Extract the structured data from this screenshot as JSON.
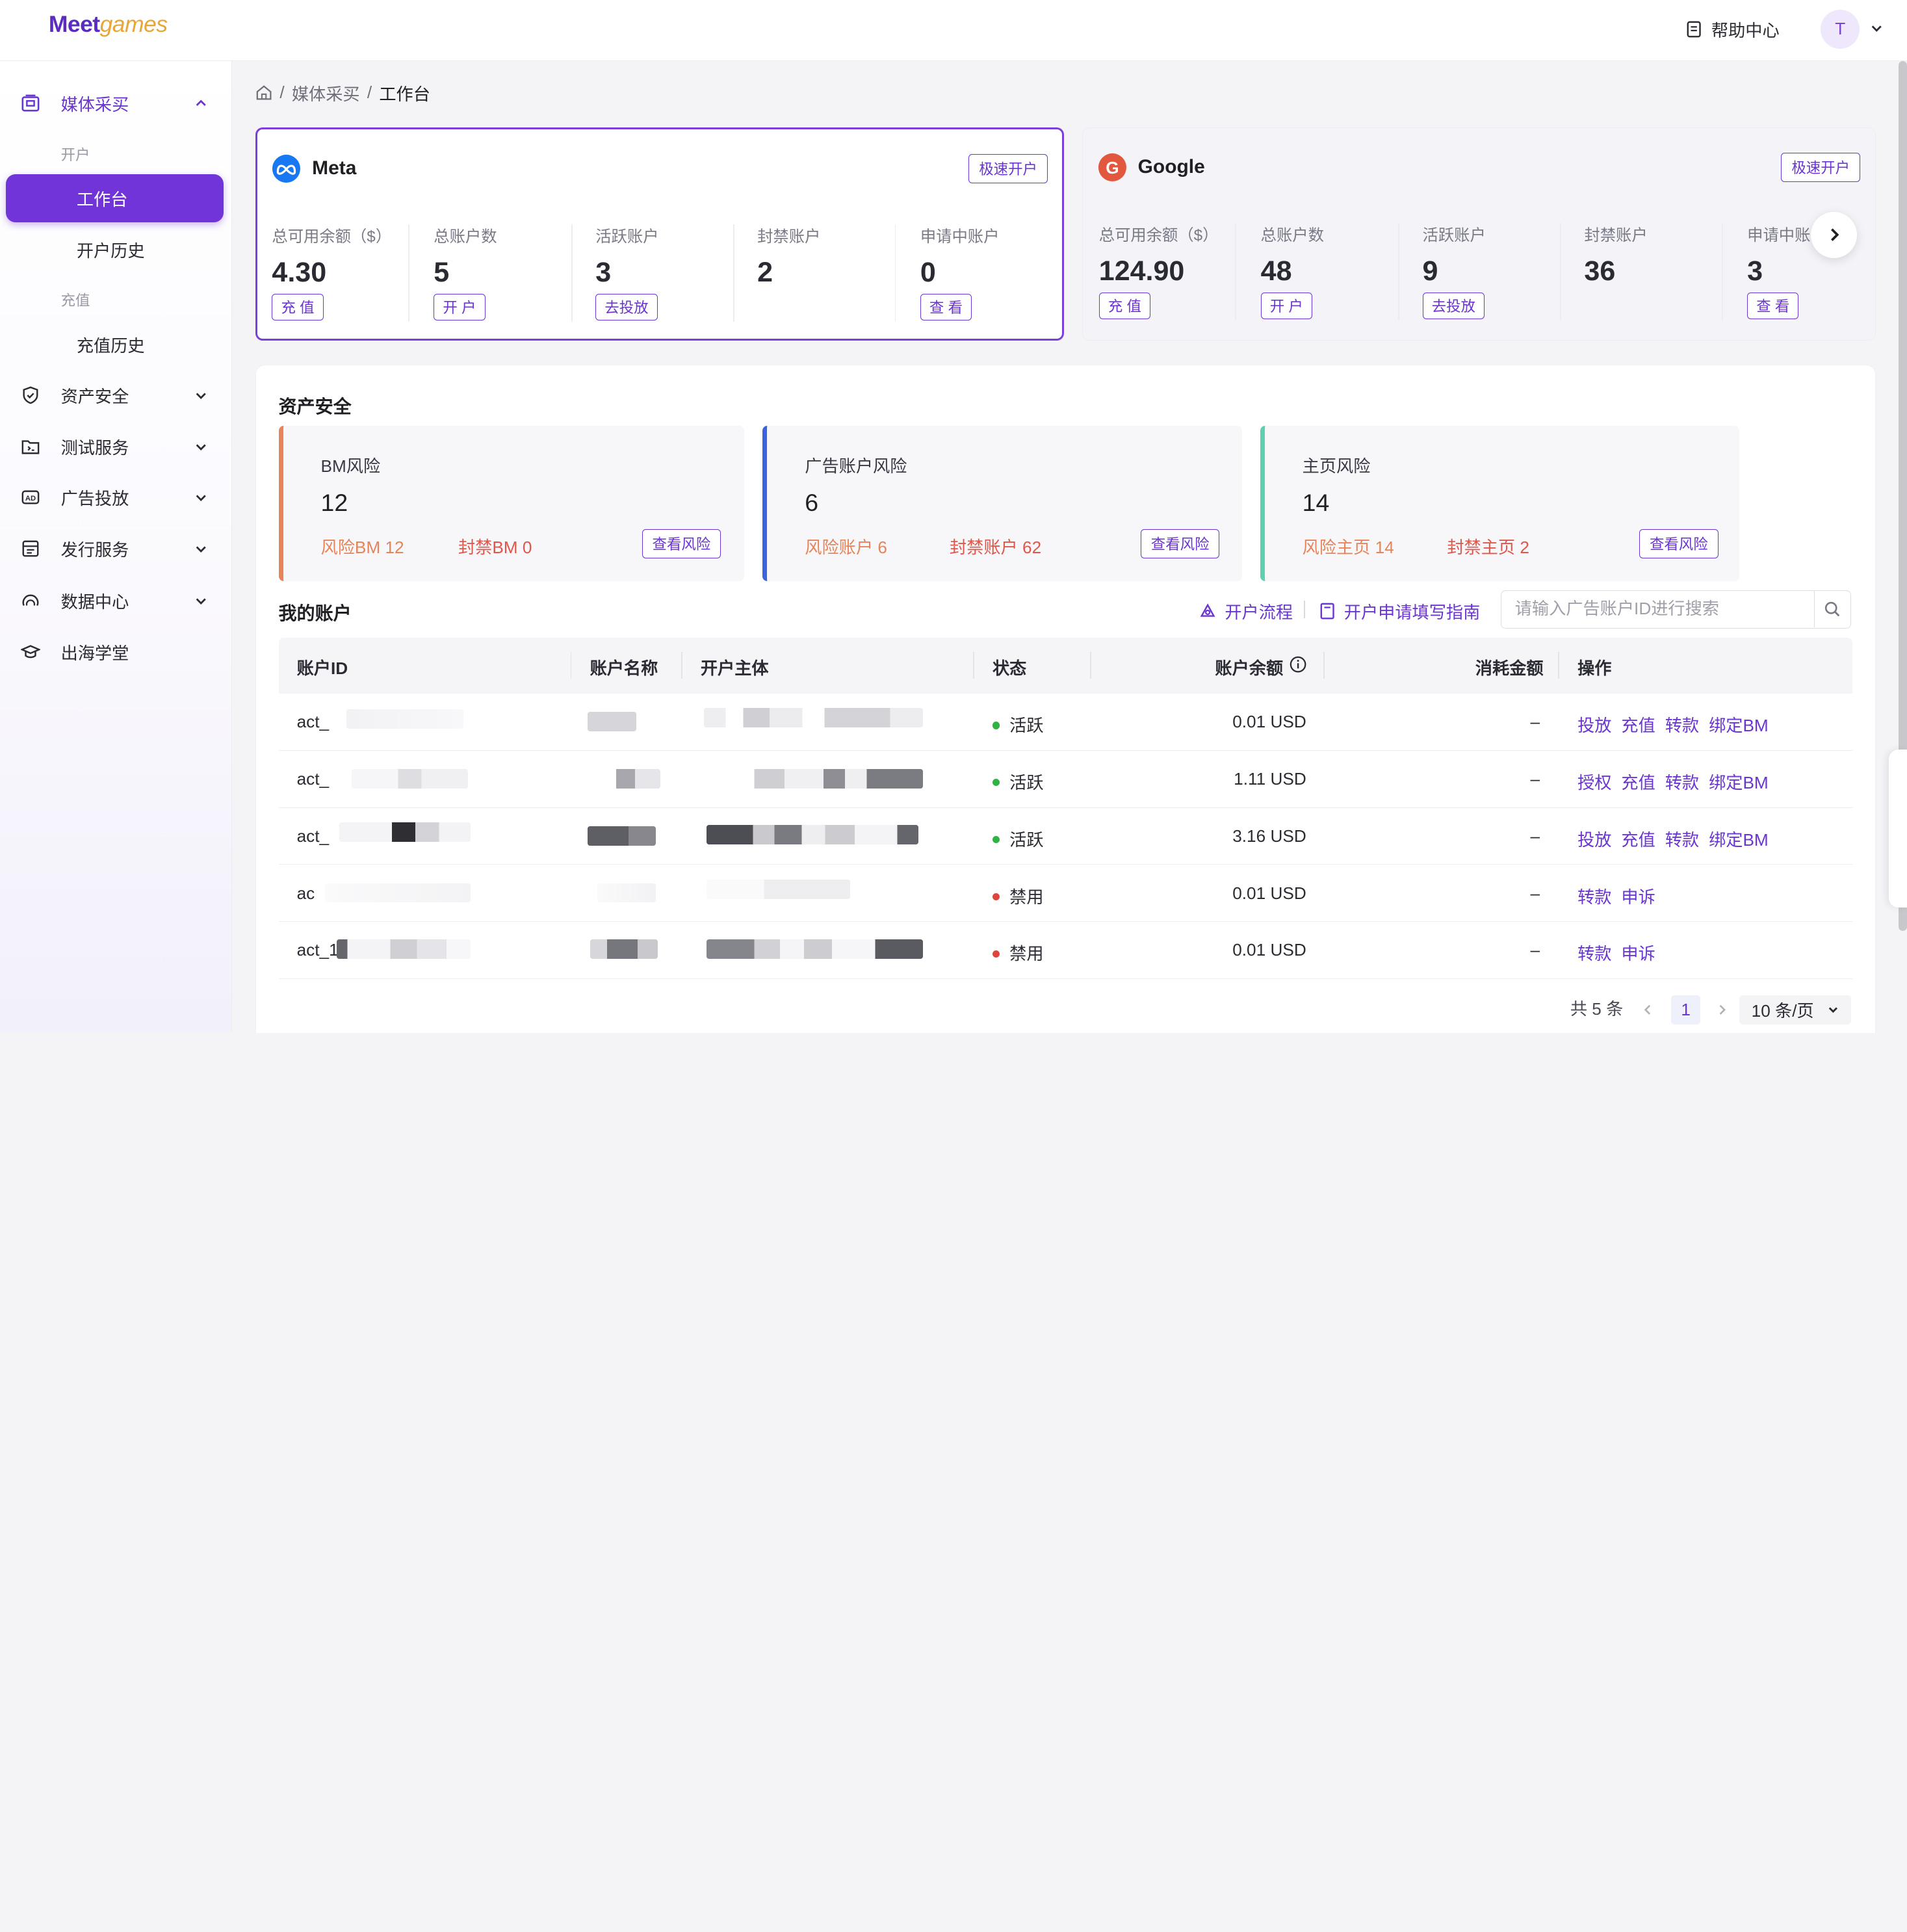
{
  "header": {
    "logo_a": "Meet",
    "logo_b": "games",
    "help_label": "帮助中心",
    "avatar_letter": "T"
  },
  "sidebar": {
    "groups": [
      {
        "label": "媒体采买",
        "icon": "media-buy-icon",
        "expanded": true
      },
      {
        "label": "资产安全",
        "icon": "shield-icon"
      },
      {
        "label": "测试服务",
        "icon": "test-folder-icon"
      },
      {
        "label": "广告投放",
        "icon": "ad-icon"
      },
      {
        "label": "发行服务",
        "icon": "publish-icon"
      },
      {
        "label": "数据中心",
        "icon": "gauge-icon"
      },
      {
        "label": "出海学堂",
        "icon": "graduation-cap-icon"
      }
    ],
    "section_open": "开户",
    "section_recharge": "充值",
    "items": [
      {
        "label": "工作台",
        "active": true
      },
      {
        "label": "开户历史"
      },
      {
        "label": "充值历史"
      }
    ]
  },
  "breadcrumb": {
    "sep": "/",
    "parent": "媒体采买",
    "current": "工作台"
  },
  "platforms": [
    {
      "name": "Meta",
      "quick_btn": "极速开户",
      "stats": [
        {
          "label": "总可用余额（$）",
          "value": "4.30",
          "action": "充 值"
        },
        {
          "label": "总账户数",
          "value": "5",
          "action": "开 户"
        },
        {
          "label": "活跃账户",
          "value": "3",
          "action": "去投放"
        },
        {
          "label": "封禁账户",
          "value": "2",
          "action": ""
        },
        {
          "label": "申请中账户",
          "value": "0",
          "action": "查 看"
        }
      ]
    },
    {
      "name": "Google",
      "quick_btn": "极速开户",
      "stats": [
        {
          "label": "总可用余额（$）",
          "value": "124.90",
          "action": "充 值"
        },
        {
          "label": "总账户数",
          "value": "48",
          "action": "开 户"
        },
        {
          "label": "活跃账户",
          "value": "9",
          "action": "去投放"
        },
        {
          "label": "封禁账户",
          "value": "36",
          "action": ""
        },
        {
          "label": "申请中账",
          "value": "3",
          "action": "查 看"
        }
      ]
    }
  ],
  "asset_security": {
    "title": "资产安全",
    "cards": [
      {
        "title": "BM风险",
        "count": "12",
        "a": "风险BM 12",
        "b": "封禁BM 0",
        "btn": "查看风险",
        "color": "#e6845a"
      },
      {
        "title": "广告账户风险",
        "count": "6",
        "a": "风险账户 6",
        "b": "封禁账户 62",
        "btn": "查看风险",
        "color": "#3b63e0"
      },
      {
        "title": "主页风险",
        "count": "14",
        "a": "风险主页 14",
        "b": "封禁主页 2",
        "btn": "查看风险",
        "color": "#5fcfb0"
      }
    ]
  },
  "accounts": {
    "title": "我的账户",
    "flow_link": "开户流程",
    "guide_link": "开户申请填写指南",
    "search_placeholder": "请输入广告账户ID进行搜索",
    "columns": [
      "账户ID",
      "账户名称",
      "开户主体",
      "状态",
      "账户余额",
      "消耗金额",
      "操作"
    ],
    "rows": [
      {
        "id": "act_",
        "name": "",
        "entity": "",
        "status": "活跃",
        "status_color": "#2fb344",
        "balance": "0.01 USD",
        "spend": "–",
        "ops": [
          "投放",
          "充值",
          "转款",
          "绑定BM"
        ]
      },
      {
        "id": "act_",
        "name": "",
        "entity": "",
        "status": "活跃",
        "status_color": "#2fb344",
        "balance": "1.11 USD",
        "spend": "–",
        "ops": [
          "授权",
          "充值",
          "转款",
          "绑定BM"
        ]
      },
      {
        "id": "act_",
        "name": "",
        "entity": "",
        "status": "活跃",
        "status_color": "#2fb344",
        "balance": "3.16 USD",
        "spend": "–",
        "ops": [
          "投放",
          "充值",
          "转款",
          "绑定BM"
        ]
      },
      {
        "id": "ac",
        "name": "",
        "entity": "",
        "status": "禁用",
        "status_color": "#e0453d",
        "balance": "0.01 USD",
        "spend": "–",
        "ops": [
          "转款",
          "申诉"
        ]
      },
      {
        "id": "act_1",
        "name": "",
        "entity": "",
        "status": "禁用",
        "status_color": "#e0453d",
        "balance": "0.01 USD",
        "spend": "–",
        "ops": [
          "转款",
          "申诉"
        ]
      }
    ]
  },
  "pagination": {
    "total": "共 5 条",
    "page": "1",
    "page_size": "10 条/页"
  }
}
